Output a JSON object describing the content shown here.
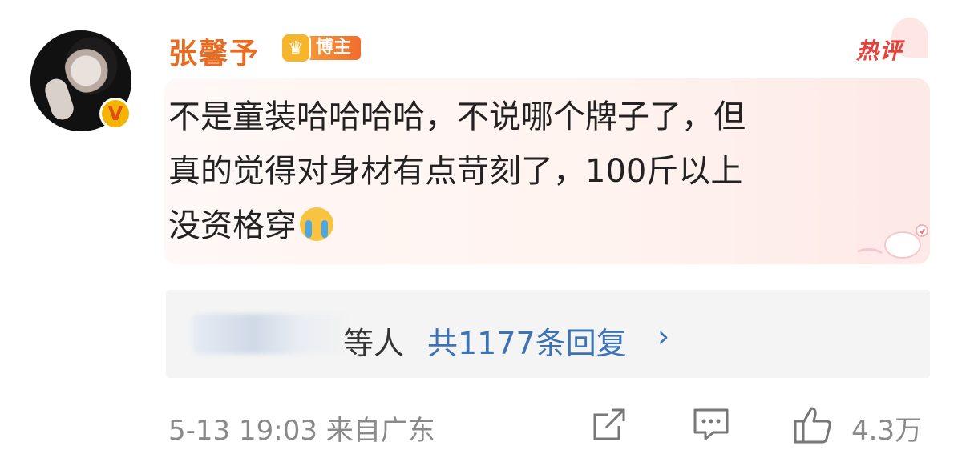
{
  "user": {
    "name": "张馨予",
    "badge_label": "博主"
  },
  "hot_label": "热评",
  "comment": {
    "line1": "不是童装哈哈哈哈，不说哪个牌子了，但",
    "line2": "真的觉得对身材有点苛刻了，100斤以上",
    "line3": "没资格穿"
  },
  "replies": {
    "others": "等人",
    "count": "共1177条回复",
    "chevron": "›"
  },
  "footer": {
    "time_location": "5-13 19:03 来自广东",
    "like_count": "4.3万"
  },
  "icons": {
    "verify": "verified-v-icon",
    "crown": "crown-icon",
    "share": "share-icon",
    "comment": "comment-icon",
    "like": "thumbs-up-icon",
    "emoji": "crying-emoji-icon"
  },
  "colors": {
    "username": "#e86b1f",
    "hot": "#e8413a",
    "link": "#3b73b6",
    "muted": "#8a8a8a"
  }
}
